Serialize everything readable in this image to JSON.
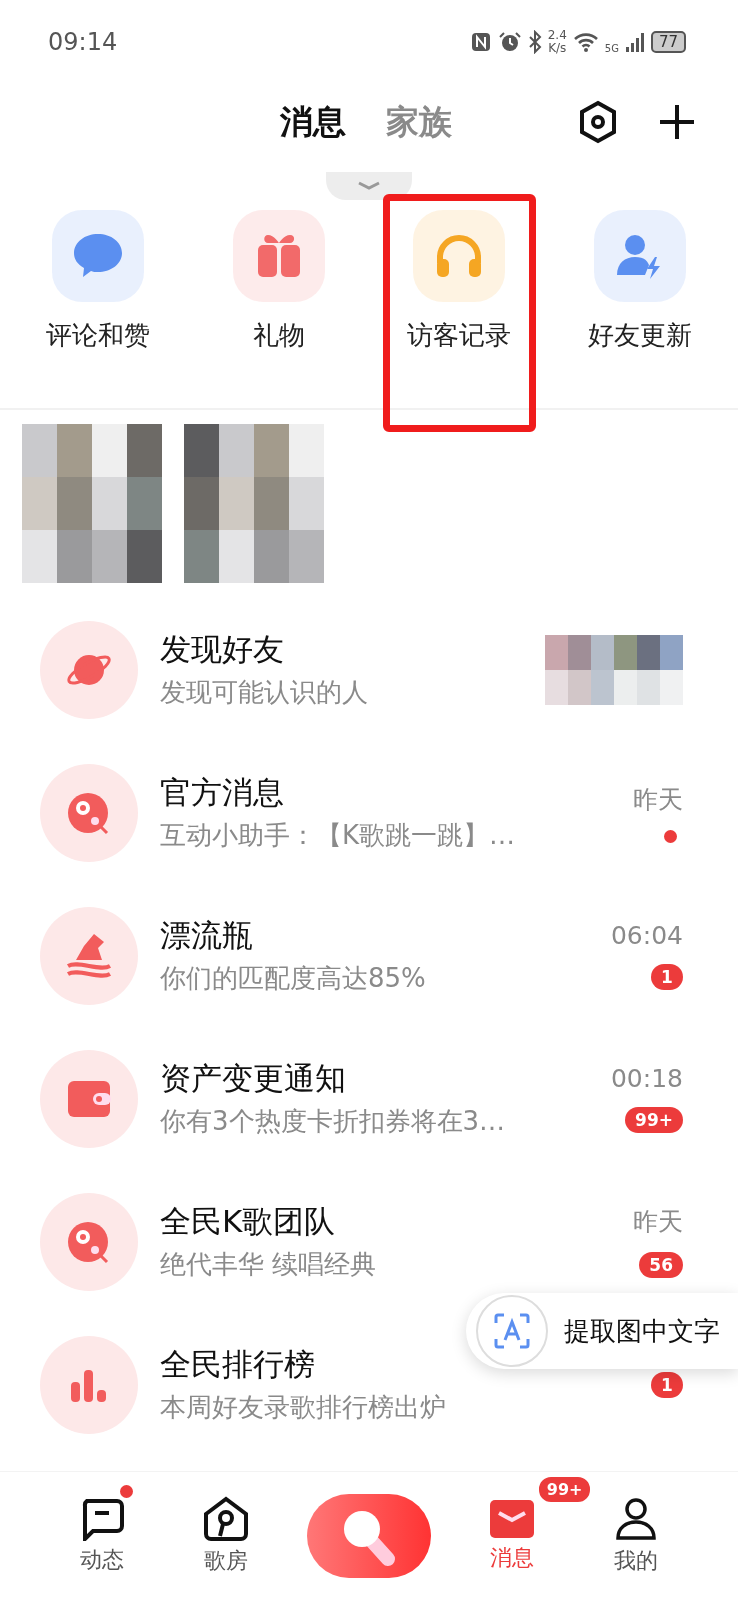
{
  "status_bar": {
    "time": "09:14",
    "speed_value": "2.4",
    "speed_unit": "K/s",
    "network": "5G",
    "battery": "77"
  },
  "header": {
    "tabs": [
      {
        "label": "消息",
        "selected": true
      },
      {
        "label": "家族",
        "selected": false
      }
    ]
  },
  "quick_actions": [
    {
      "label": "评论和赞",
      "kind": "comment",
      "color": "#5b8ff0",
      "highlighted": false
    },
    {
      "label": "礼物",
      "kind": "gift",
      "color": "#f26a6a",
      "highlighted": false
    },
    {
      "label": "访客记录",
      "kind": "headphones",
      "color": "#f5a623",
      "highlighted": true
    },
    {
      "label": "好友更新",
      "kind": "friend",
      "color": "#5b8ff0",
      "highlighted": false
    }
  ],
  "conversations": [
    {
      "kind": "planet",
      "title": "发现好友",
      "subtitle": "发现可能认识的人",
      "thumbnail": true
    },
    {
      "kind": "mascot",
      "title": "官方消息",
      "subtitle": "互动小助手：【K歌跳一跳】…",
      "time": "昨天",
      "unread_dot": true
    },
    {
      "kind": "bottle",
      "title": "漂流瓶",
      "subtitle": "你们的匹配度高达85%",
      "time": "06:04",
      "badge": "1"
    },
    {
      "kind": "wallet",
      "title": "资产变更通知",
      "subtitle": "你有3个热度卡折扣券将在3…",
      "time": "00:18",
      "badge": "99+"
    },
    {
      "kind": "mascot",
      "title": "全民K歌团队",
      "subtitle": "绝代丰华 续唱经典",
      "time": "昨天",
      "badge": "56"
    },
    {
      "kind": "chart",
      "title": "全民排行榜",
      "subtitle": "本周好友录歌排行榜出炉",
      "badge": "1"
    }
  ],
  "floating_action": {
    "label": "提取图中文字"
  },
  "bottom_nav": [
    {
      "kind": "feed",
      "label": "动态",
      "selected": false,
      "dot": true
    },
    {
      "kind": "room",
      "label": "歌房",
      "selected": false
    },
    {
      "kind": "mic"
    },
    {
      "kind": "mail",
      "label": "消息",
      "selected": true,
      "badge": "99+"
    },
    {
      "kind": "profile",
      "label": "我的",
      "selected": false
    }
  ]
}
